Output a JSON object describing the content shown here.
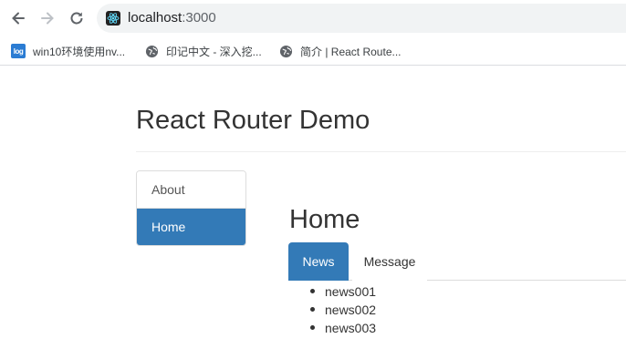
{
  "browser": {
    "url_host": "localhost",
    "url_port": ":3000",
    "bookmarks": [
      {
        "label": "win10环境使用nv...",
        "icon": "log-badge-icon",
        "badge_text": "log"
      },
      {
        "label": "印记中文 - 深入挖...",
        "icon": "globe-icon"
      },
      {
        "label": "简介 | React Route...",
        "icon": "globe-icon"
      }
    ]
  },
  "page": {
    "title": "React Router Demo",
    "side_nav": {
      "items": [
        {
          "label": "About",
          "active": false
        },
        {
          "label": "Home",
          "active": true
        }
      ]
    },
    "home": {
      "title": "Home",
      "tabs": [
        {
          "label": "News",
          "active": true
        },
        {
          "label": "Message",
          "active": false
        }
      ],
      "news": [
        "news001",
        "news002",
        "news003"
      ]
    }
  },
  "colors": {
    "accent": "#337ab7",
    "border": "#dddddd"
  }
}
